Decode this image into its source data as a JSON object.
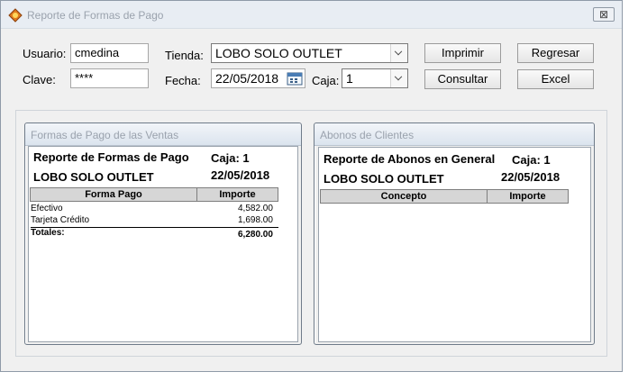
{
  "window": {
    "title": "Reporte de Formas de Pago",
    "close": "⊠"
  },
  "form": {
    "usuario_label": "Usuario:",
    "usuario_value": "cmedina",
    "clave_label": "Clave:",
    "clave_value": "****",
    "tienda_label": "Tienda:",
    "tienda_value": "LOBO SOLO OUTLET",
    "fecha_label": "Fecha:",
    "fecha_value": "22/05/2018",
    "caja_label": "Caja:",
    "caja_value": "1"
  },
  "buttons": {
    "imprimir": "Imprimir",
    "regresar": "Regresar",
    "consultar": "Consultar",
    "excel": "Excel"
  },
  "ventas": {
    "group_title": "Formas de Pago de las Ventas",
    "report_title": "Reporte de Formas de Pago",
    "caja": "Caja: 1",
    "store": "LOBO SOLO OUTLET",
    "date": "22/05/2018",
    "columns": [
      "Forma Pago",
      "Importe"
    ],
    "rows": [
      {
        "forma": "Efectivo",
        "importe": "4,582.00"
      },
      {
        "forma": "Tarjeta Crédito",
        "importe": "1,698.00"
      }
    ],
    "totals_label": "Totales:",
    "totals_value": "6,280.00"
  },
  "abonos": {
    "group_title": "Abonos de Clientes",
    "report_title": "Reporte de Abonos en General",
    "caja": "Caja: 1",
    "store": "LOBO SOLO OUTLET",
    "date": "22/05/2018",
    "columns": [
      "Concepto",
      "Importe"
    ]
  }
}
